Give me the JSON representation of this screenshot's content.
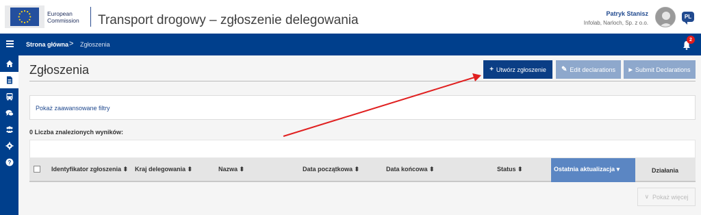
{
  "header": {
    "logo_line1": "European",
    "logo_line2": "Commission",
    "app_title": "Transport drogowy – zgłoszenie delegowania",
    "user_name": "Patryk Stanisz",
    "user_org": "Infolab, Narloch, Sp. z o.o.",
    "language": "PL"
  },
  "navbar": {
    "breadcrumb_home": "Strona główna",
    "breadcrumb_separator": ">",
    "breadcrumb_current": "Zgłoszenia",
    "notification_count": "2"
  },
  "sidebar": {
    "items": [
      {
        "icon": "home-icon"
      },
      {
        "icon": "document-icon",
        "active": true
      },
      {
        "icon": "bus-icon"
      },
      {
        "icon": "chat-icon"
      },
      {
        "icon": "users-icon"
      },
      {
        "icon": "gear-icon"
      },
      {
        "icon": "help-icon"
      }
    ]
  },
  "page": {
    "title": "Zgłoszenia",
    "buttons": {
      "create": "Utwórz zgłoszenie",
      "edit": "Edit declarations",
      "submit": "Submit Declarations"
    },
    "filter_link": "Pokaż zaawansowane filtry",
    "results_count": "0 Liczba znalezionych wyników:",
    "show_more": "Pokaż więcej"
  },
  "table": {
    "columns": [
      "Identyfikator zgłoszenia",
      "Kraj delegowania",
      "Nazwa",
      "Data początkowa",
      "Data końcowa",
      "Status",
      "Ostatnia aktualizacja",
      "Działania"
    ],
    "sorted_column": "Ostatnia aktualizacja",
    "rows": []
  },
  "colors": {
    "primary": "#003f8c",
    "button_primary": "#0b3e85",
    "button_disabled": "#8ea8cc",
    "sorted_header": "#5b86c3",
    "annotation_arrow": "#e02020"
  }
}
